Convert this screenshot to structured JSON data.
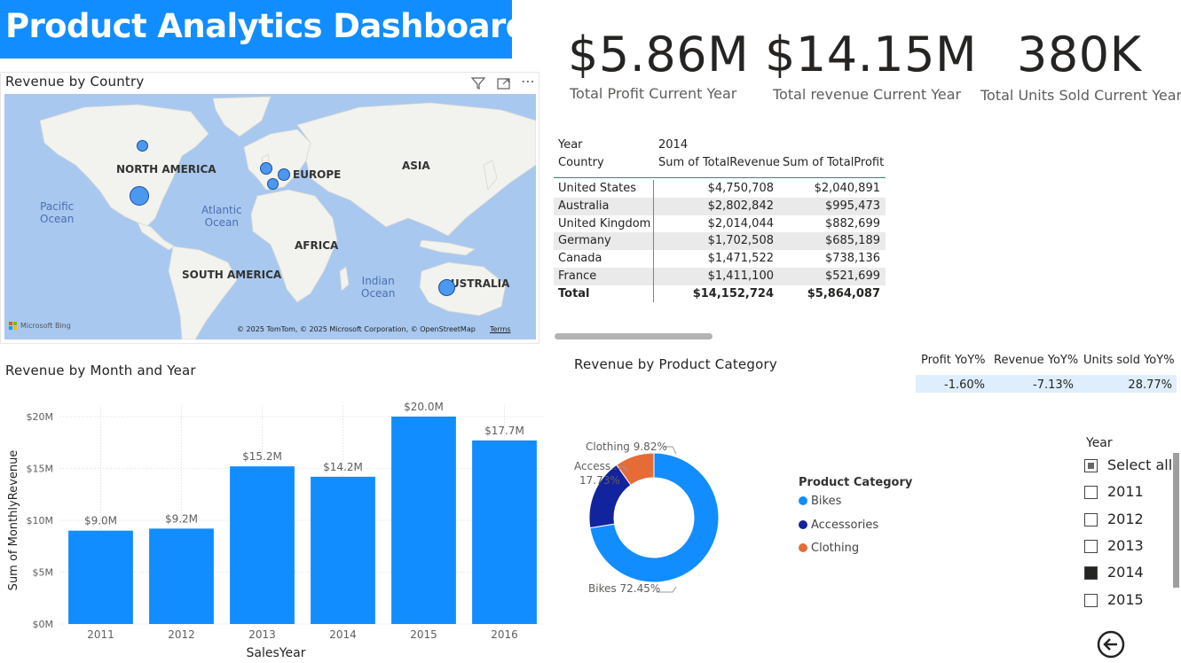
{
  "title": "Product Analytics Dashboard",
  "map": {
    "title": "Revenue by Country",
    "continents": [
      "NORTH AMERICA",
      "EUROPE",
      "ASIA",
      "AFRICA",
      "SOUTH AMERICA",
      "AUSTRALIA"
    ],
    "oceans": [
      "Pacific\nOcean",
      "Atlantic\nOcean",
      "Indian\nOcean"
    ],
    "attribution": "Microsoft Bing",
    "copyright": "© 2025 TomTom, © 2025 Microsoft Corporation, © OpenStreetMap",
    "terms": "Terms"
  },
  "kpis": [
    {
      "value": "$5.86M",
      "label": "Total Profit Current Year"
    },
    {
      "value": "$14.15M",
      "label": "Total revenue Current Year"
    },
    {
      "value": "380K",
      "label": "Total Units Sold Current Year"
    }
  ],
  "matrix": {
    "year_label": "Year",
    "year_value": "2014",
    "col_country": "Country",
    "col_revenue": "Sum of TotalRevenue",
    "col_profit": "Sum of TotalProfit",
    "rows": [
      {
        "country": "United States",
        "revenue": "$4,750,708",
        "profit": "$2,040,891"
      },
      {
        "country": "Australia",
        "revenue": "$2,802,842",
        "profit": "$995,473"
      },
      {
        "country": "United Kingdom",
        "revenue": "$2,014,044",
        "profit": "$882,699"
      },
      {
        "country": "Germany",
        "revenue": "$1,702,508",
        "profit": "$685,189"
      },
      {
        "country": "Canada",
        "revenue": "$1,471,522",
        "profit": "$738,136"
      },
      {
        "country": "France",
        "revenue": "$1,411,100",
        "profit": "$521,699"
      }
    ],
    "total": {
      "country": "Total",
      "revenue": "$14,152,724",
      "profit": "$5,864,087"
    }
  },
  "chart_data": [
    {
      "type": "bar",
      "title": "Revenue by Month and Year",
      "xlabel": "SalesYear",
      "ylabel": "Sum of MonthlyRevenue",
      "categories": [
        "2011",
        "2012",
        "2013",
        "2014",
        "2015",
        "2016"
      ],
      "values": [
        9.0,
        9.2,
        15.2,
        14.2,
        20.0,
        17.7
      ],
      "data_labels": [
        "$9.0M",
        "$9.2M",
        "$15.2M",
        "$14.2M",
        "$20.0M",
        "$17.7M"
      ],
      "yticks": [
        "$0M",
        "$5M",
        "$10M",
        "$15M",
        "$20M"
      ],
      "ylim": [
        0,
        20
      ],
      "color": "#118DFF"
    },
    {
      "type": "pie",
      "title": "Revenue by Product Category",
      "legend_title": "Product Category",
      "categories": [
        "Bikes",
        "Accessories",
        "Clothing"
      ],
      "values": [
        72.45,
        17.73,
        9.82
      ],
      "data_labels": [
        "Bikes 72.45%",
        "Access...",
        "17.73%",
        "Clothing 9.82%"
      ],
      "colors": [
        "#118DFF",
        "#12239E",
        "#E66C37"
      ]
    }
  ],
  "yoy": {
    "headers": [
      "Profit YoY%",
      "Revenue YoY%",
      "Units sold YoY%"
    ],
    "values": [
      "-1.60%",
      "-7.13%",
      "28.77%"
    ]
  },
  "slicer": {
    "title": "Year",
    "items": [
      {
        "label": "Select all",
        "state": "partial"
      },
      {
        "label": "2011",
        "state": "unchecked"
      },
      {
        "label": "2012",
        "state": "unchecked"
      },
      {
        "label": "2013",
        "state": "unchecked"
      },
      {
        "label": "2014",
        "state": "checked"
      },
      {
        "label": "2015",
        "state": "unchecked"
      }
    ]
  }
}
